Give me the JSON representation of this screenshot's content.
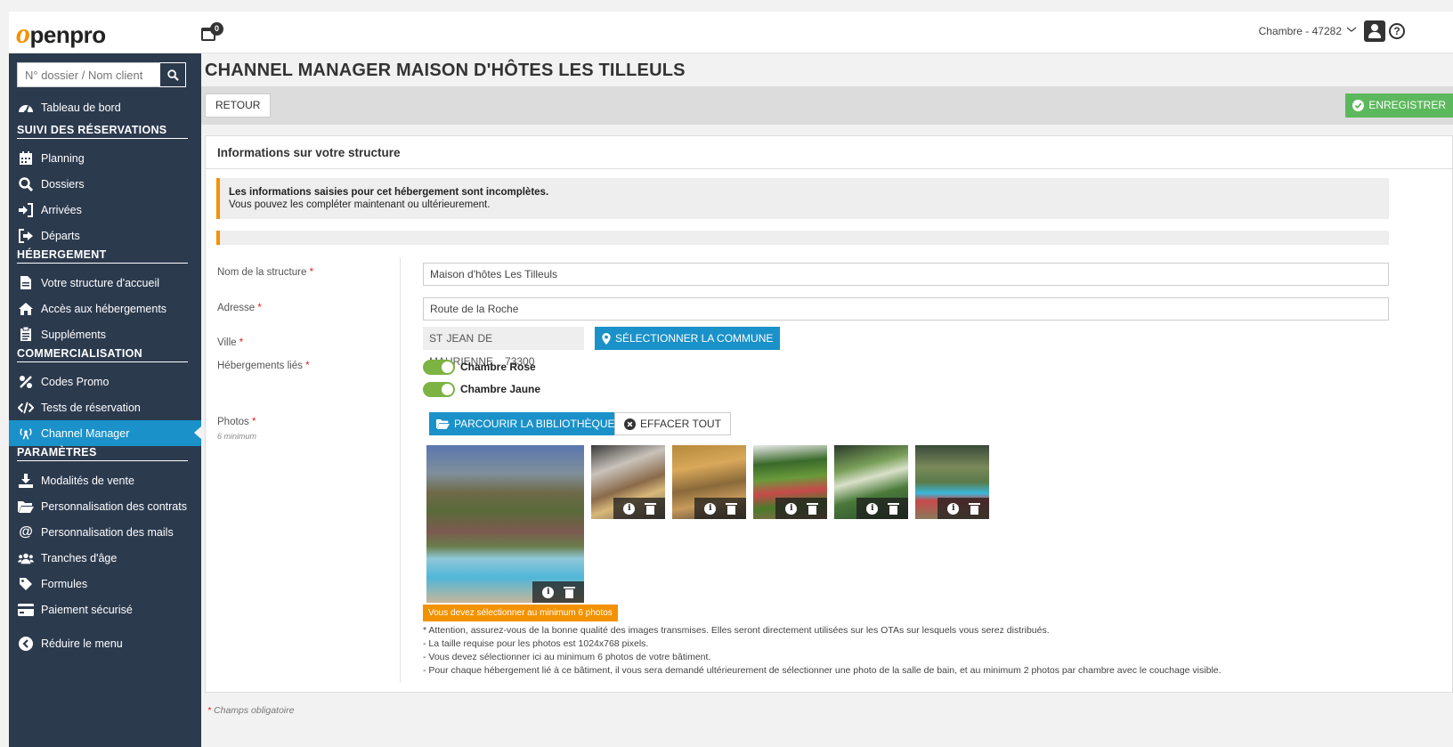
{
  "header": {
    "logo_initial": "o",
    "logo_rest": "penpro",
    "calendar_badge": "0",
    "account_label": "Chambre - 47282",
    "help_glyph": "?"
  },
  "sidebar": {
    "search_placeholder": "N° dossier / Nom client",
    "items": [
      {
        "label": "Tableau de bord",
        "icon": "gauge-icon"
      },
      {
        "label": "Planning",
        "icon": "calendar-icon"
      },
      {
        "label": "Dossiers",
        "icon": "search-icon"
      },
      {
        "label": "Arrivées",
        "icon": "sign-in-icon"
      },
      {
        "label": "Départs",
        "icon": "sign-out-icon"
      },
      {
        "label": "Votre structure d'accueil",
        "icon": "file-icon"
      },
      {
        "label": "Accès aux hébergements",
        "icon": "home-icon"
      },
      {
        "label": "Suppléments",
        "icon": "clipboard-icon"
      },
      {
        "label": "Codes Promo",
        "icon": "percent-icon"
      },
      {
        "label": "Tests de réservation",
        "icon": "code-icon"
      },
      {
        "label": "Channel Manager",
        "icon": "broadcast-icon"
      },
      {
        "label": "Modalités de vente",
        "icon": "download-icon"
      },
      {
        "label": "Personnalisation des contrats",
        "icon": "folder-icon"
      },
      {
        "label": "Personnalisation des mails",
        "icon": "at-icon"
      },
      {
        "label": "Tranches d'âge",
        "icon": "users-icon"
      },
      {
        "label": "Formules",
        "icon": "tag-icon"
      },
      {
        "label": "Paiement sécurisé",
        "icon": "credit-card-icon"
      },
      {
        "label": "Réduire le menu",
        "icon": "chevron-left-circle-icon"
      }
    ],
    "sections": [
      "SUIVI DES RÉSERVATIONS",
      "HÉBERGEMENT",
      "COMMERCIALISATION",
      "PARAMÈTRES"
    ]
  },
  "page": {
    "title": "CHANNEL MANAGER MAISON D'HÔTES LES TILLEULS",
    "back_label": "RETOUR",
    "save_label": "ENREGISTRER"
  },
  "panel": {
    "title": "Informations sur votre structure",
    "alert_title": "Les informations saisies pour cet hébergement sont incomplètes.",
    "alert_text": "Vous pouvez les compléter maintenant ou ultérieurement."
  },
  "form": {
    "name_label": "Nom de la structure",
    "name_value": "Maison d'hôtes Les Tilleuls",
    "address_label": "Adresse",
    "address_value": "Route de la Roche",
    "city_label": "Ville",
    "city_value": "ST JEAN DE MAURIENNE",
    "postcode_value": "73300",
    "select_city_label": "SÉLECTIONNER LA COMMUNE",
    "linked_label": "Hébergements liés",
    "linked": [
      {
        "label": "Chambre Rose",
        "on": true
      },
      {
        "label": "Chambre Jaune",
        "on": true
      }
    ],
    "photos_label": "Photos",
    "photos_sublabel": "6 minimum",
    "browse_label": "PARCOURIR LA BIBLIOTHÈQUE",
    "clear_label": "EFFACER TOUT",
    "photo_count": 6,
    "warning": "Vous devez sélectionner au minimum 6 photos",
    "notes": [
      "* Attention, assurez-vous de la bonne qualité des images transmises. Elles seront directement utilisées sur les OTAs sur lesquels vous serez distribués.",
      "- La taille requise pour les photos est 1024x768 pixels.",
      "- Vous devez sélectionner ici au minimum 6 photos de votre bâtiment.",
      "- Pour chaque hébergement lié à ce bâtiment, il vous sera demandé ultérieurement de sélectionner une photo de la salle de bain, et au minimum 2 photos par chambre avec le couchage visible."
    ],
    "required_star": "*",
    "required_note": "Champs obligatoire"
  },
  "colors": {
    "sidebar_bg": "#2c3a4e",
    "active_blue": "#1a91c9",
    "brand_orange": "#f39200",
    "save_green": "#5cb85c",
    "toggle_green": "#7cb342",
    "required_red": "#e02020"
  }
}
